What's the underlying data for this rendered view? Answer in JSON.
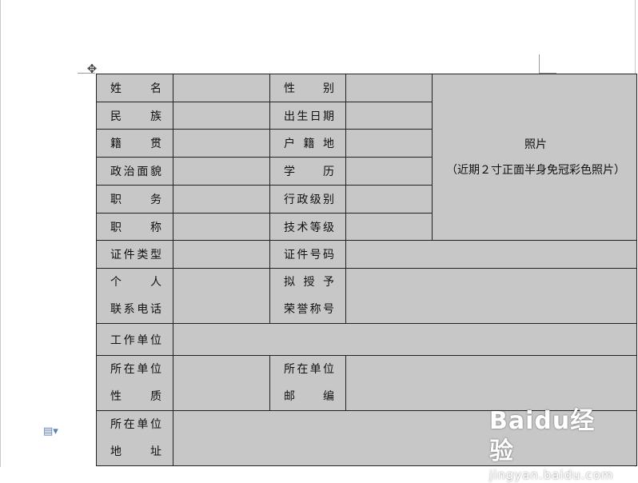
{
  "form": {
    "name_label": "姓名",
    "gender_label": "性别",
    "ethnicity_label": "民族",
    "birthdate_label": "出生日期",
    "native_place_label": "籍贯",
    "household_label": "户籍地",
    "political_label": "政治面貌",
    "education_label": "学历",
    "position_label": "职务",
    "admin_level_label": "行政级别",
    "title_label": "职称",
    "tech_grade_label": "技术等级",
    "id_type_label": "证件类型",
    "id_number_label": "证件号码",
    "personal_label": "个人",
    "phone_label": "联系电话",
    "proposed_label": "拟授予",
    "honor_label": "荣誉称号",
    "workplace_label": "工作单位",
    "unit_label_a": "所在单位",
    "nature_label": "性质",
    "unit_label_b": "所在单位",
    "postcode_label": "邮编",
    "unit_label_c": "所在单位",
    "address_label": "地址",
    "photo_title": "照片",
    "photo_note": "（近期２寸正面半身免冠彩色照片）"
  },
  "icons": {
    "move_handle": "move-arrows-icon",
    "paste_options": "document-icon"
  },
  "watermark": {
    "brand": "Baidu经验",
    "url": "jingyan.baidu.com"
  }
}
